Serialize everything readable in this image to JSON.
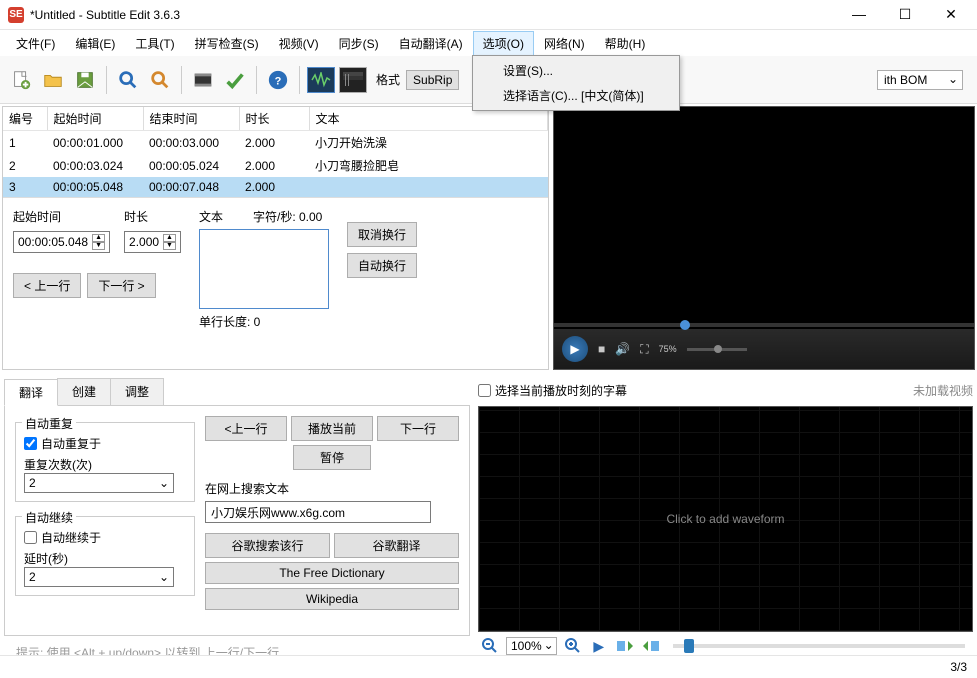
{
  "title": "*Untitled - Subtitle Edit 3.6.3",
  "win": {
    "min": "—",
    "max": "☐",
    "close": "✕"
  },
  "menu": [
    "文件(F)",
    "编辑(E)",
    "工具(T)",
    "拼写检查(S)",
    "视频(V)",
    "同步(S)",
    "自动翻译(A)",
    "选项(O)",
    "网络(N)",
    "帮助(H)"
  ],
  "dropdown": {
    "settings": "设置(S)...",
    "lang": "选择语言(C)... [中文(简体)]"
  },
  "toolbar": {
    "format_label": "格式",
    "format_value": "SubRip",
    "encoding": "ith BOM"
  },
  "table": {
    "cols": {
      "num": "编号",
      "start": "起始时间",
      "end": "结束时间",
      "dur": "时长",
      "text": "文本"
    },
    "rows": [
      {
        "n": "1",
        "s": "00:00:01.000",
        "e": "00:00:03.000",
        "d": "2.000",
        "t": "小刀开始洗澡"
      },
      {
        "n": "2",
        "s": "00:00:03.024",
        "e": "00:00:05.024",
        "d": "2.000",
        "t": "小刀弯腰捡肥皂"
      },
      {
        "n": "3",
        "s": "00:00:05.048",
        "e": "00:00:07.048",
        "d": "2.000",
        "t": ""
      }
    ]
  },
  "edit": {
    "start_label": "起始时间",
    "start_value": "00:00:05.048",
    "dur_label": "时长",
    "dur_value": "2.000",
    "text_label": "文本",
    "cps_label": "字符/秒: 0.00",
    "prev": "< 上一行",
    "next": "下一行 >",
    "line_len": "单行长度: 0",
    "cancel_wrap": "取消换行",
    "auto_wrap": "自动换行"
  },
  "video": {
    "speed": "75%"
  },
  "tabs": {
    "translate": "翻译",
    "create": "创建",
    "adjust": "调整"
  },
  "repeat": {
    "box": "自动重复",
    "check": "自动重复于",
    "count_label": "重复次数(次)",
    "count_value": "2"
  },
  "cont": {
    "box": "自动继续",
    "check": "自动继续于",
    "delay_label": "延时(秒)",
    "delay_value": "2"
  },
  "play": {
    "prev": "<上一行",
    "play": "播放当前",
    "next": "下一行",
    "pause": "暂停"
  },
  "search": {
    "label": "在网上搜索文本",
    "value": "小刀娱乐网www.x6g.com",
    "google_line": "谷歌搜索该行",
    "google_trans": "谷歌翻译",
    "free_dict": "The Free Dictionary",
    "wiki": "Wikipedia"
  },
  "wave": {
    "sel_check": "选择当前播放时刻的字幕",
    "no_video": "未加载视频",
    "placeholder": "Click to add waveform",
    "zoom": "100%"
  },
  "tip": "提示: 使用 <Alt + up/down> 以转到 上一行/下一行",
  "status": "3/3"
}
